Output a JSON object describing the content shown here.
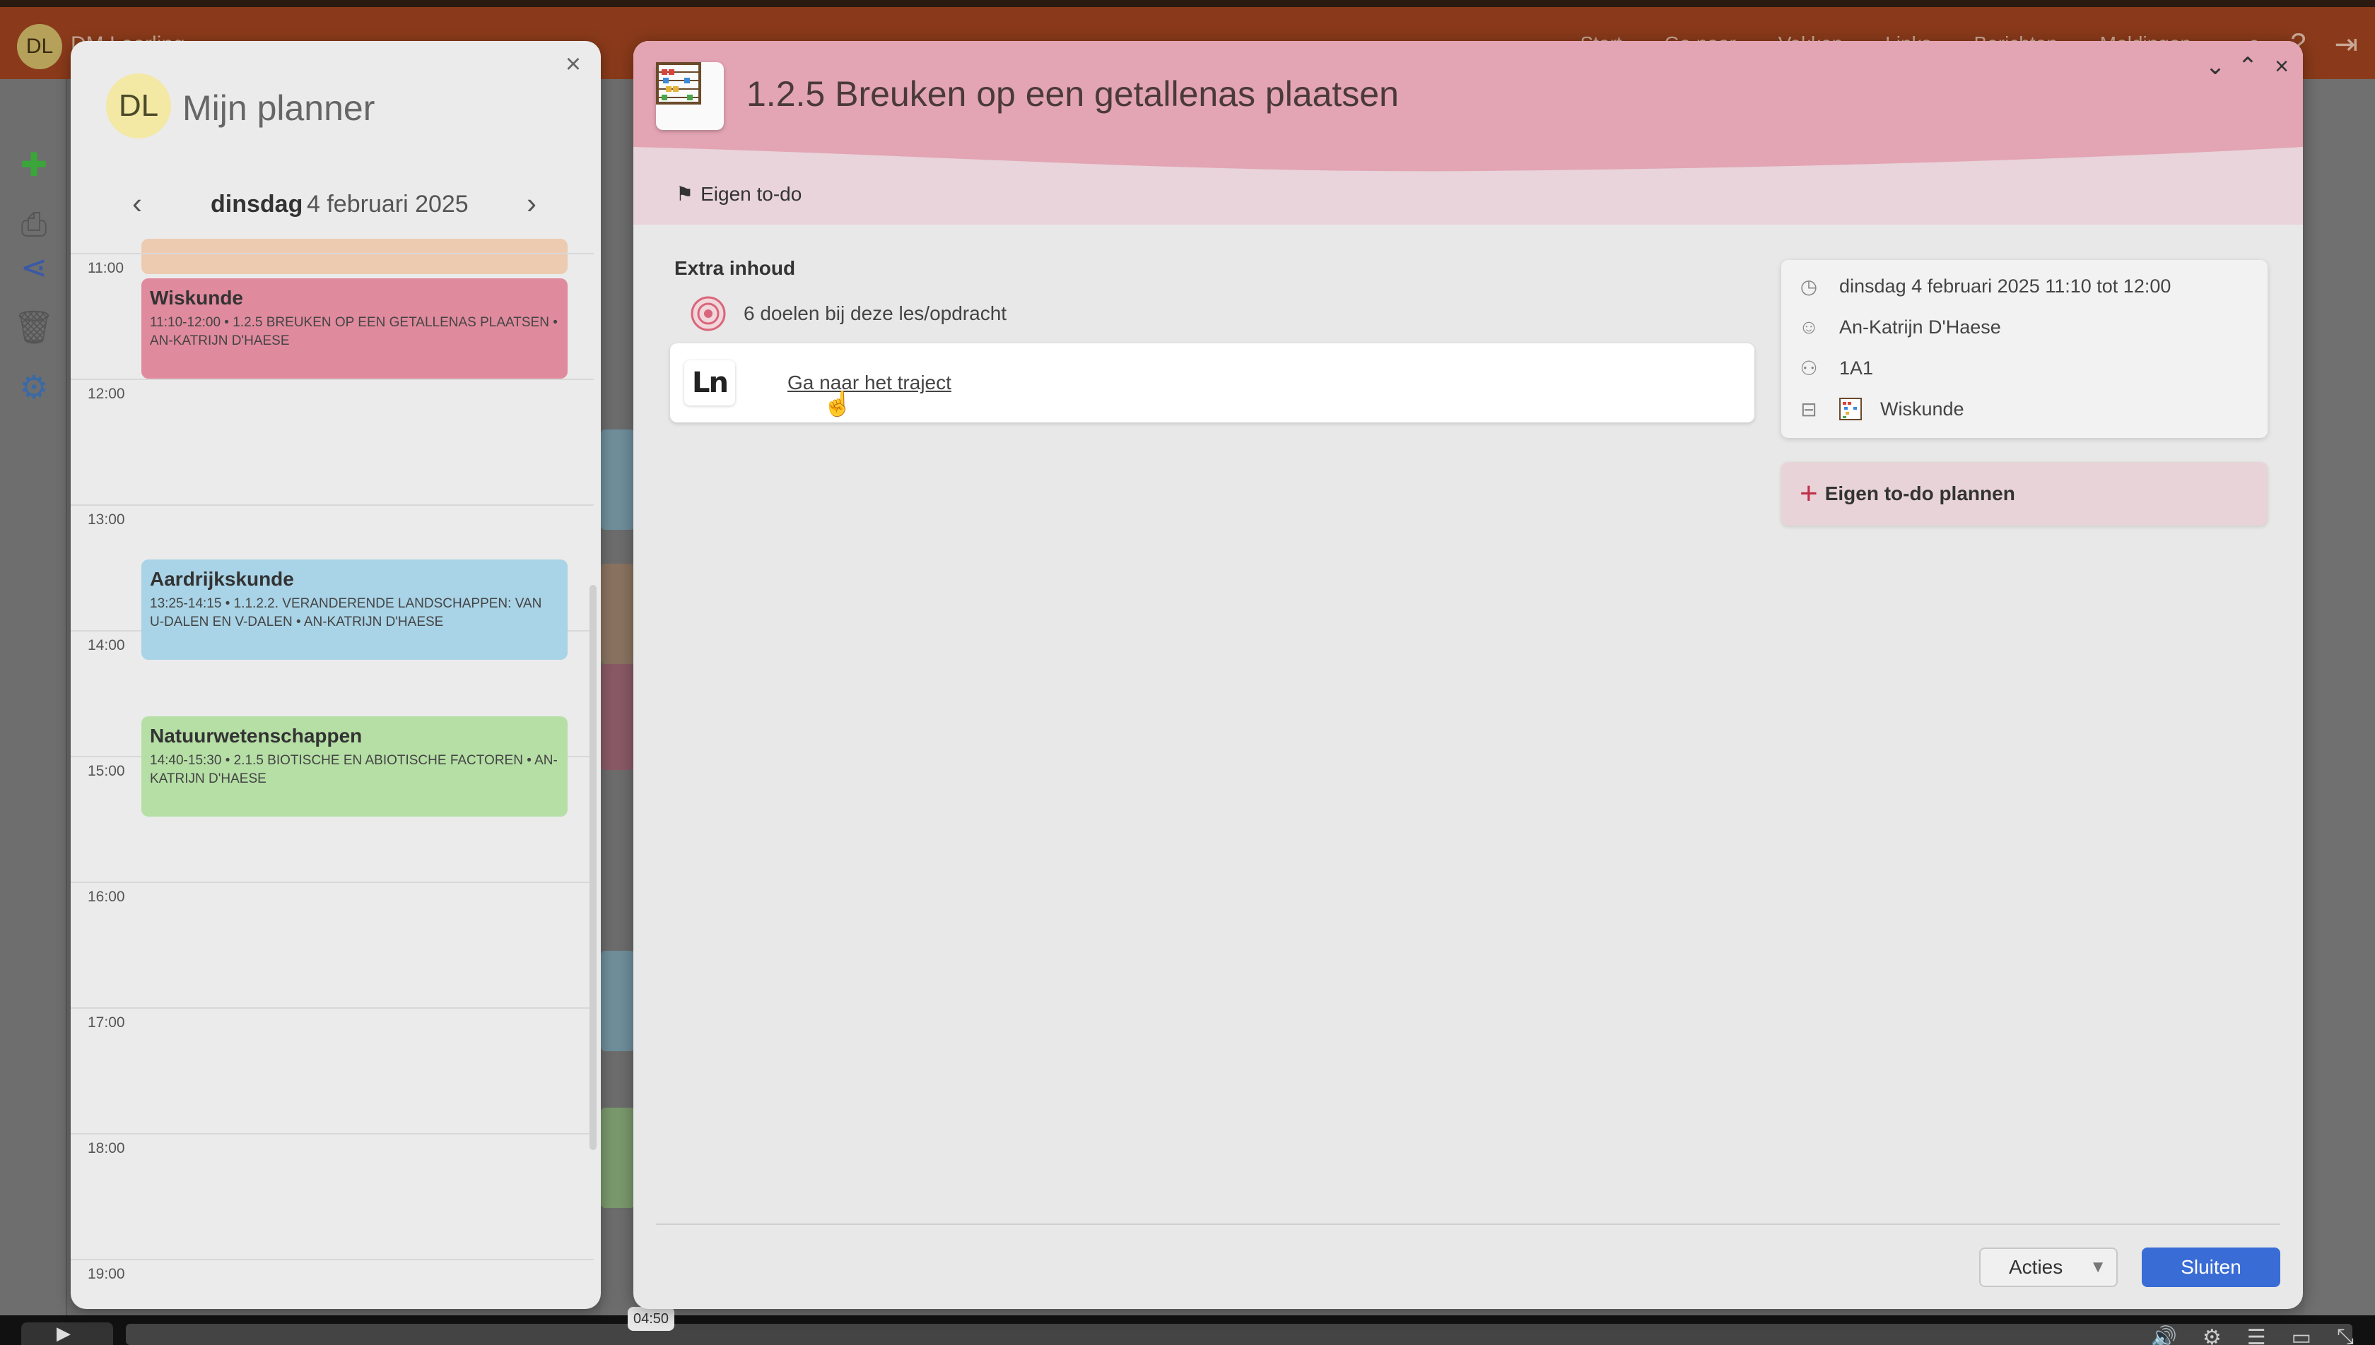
{
  "app": {
    "user_initials": "DL",
    "user_name": "DM Leerling",
    "nav": [
      "Start",
      "Ga naar",
      "Vakken",
      "Links",
      "Berichten",
      "Meldingen"
    ]
  },
  "planner": {
    "initials": "DL",
    "title": "Mijn planner",
    "day": "dinsdag",
    "date": "4 februari 2025",
    "hours": [
      "11:00",
      "12:00",
      "13:00",
      "14:00",
      "15:00",
      "16:00",
      "17:00",
      "18:00",
      "19:00"
    ],
    "events": [
      {
        "title": "Wiskunde",
        "detail": "11:10-12:00 • 1.2.5 Breuken op een getallenas plaatsen • An-Katrijn D'Haese",
        "color": "#e08a9e"
      },
      {
        "title": "Aardrijkskunde",
        "detail": "13:25-14:15 • 1.1.2.2. Veranderende landschappen: van U-dalen en V-dalen • An-Katrijn D'Haese",
        "color": "#a9d3e6"
      },
      {
        "title": "Natuurwetenschappen",
        "detail": "14:40-15:30 • 2.1.5 Biotische en abiotische factoren • An-Katrijn D'Haese",
        "color": "#b6dfa6"
      }
    ]
  },
  "modal": {
    "title": "1.2.5 Breuken op een getallenas plaatsen",
    "tab_label": "Eigen to-do",
    "section_title": "Extra inhoud",
    "goals_text": "6 doelen bij deze les/opdracht",
    "traject_link": "Ga naar het traject",
    "info": {
      "datetime": "dinsdag 4 februari 2025 11:10 tot 12:00",
      "teacher": "An-Katrijn D'Haese",
      "group": "1A1",
      "subject": "Wiskunde"
    },
    "plan_button": "Eigen to-do plannen",
    "acties_label": "Acties",
    "close_label": "Sluiten",
    "header_color": "#e3a4b4",
    "accent_color": "#3a6cd6"
  },
  "video": {
    "time": "04:50"
  }
}
